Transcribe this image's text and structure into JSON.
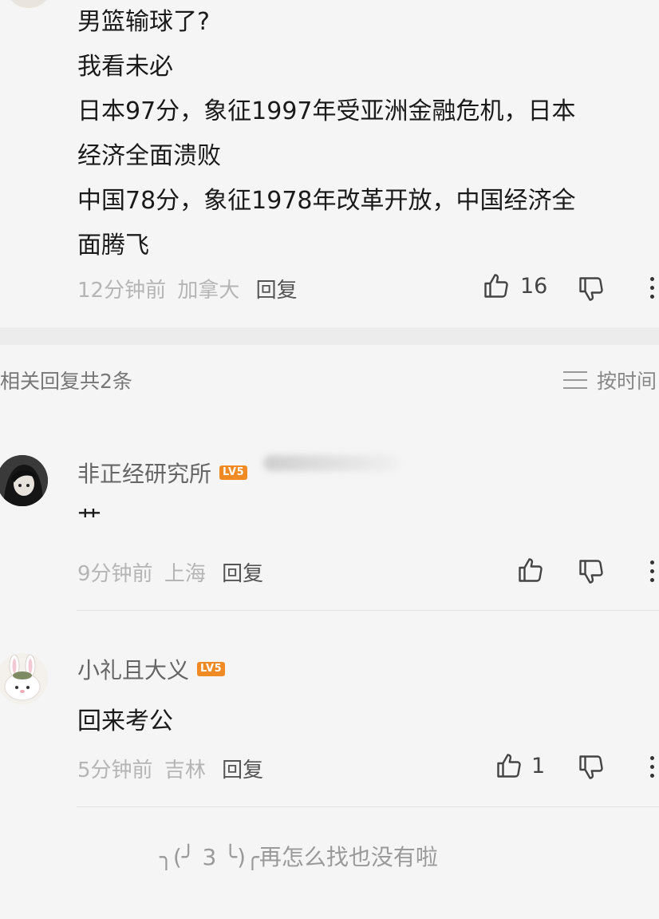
{
  "main_comment": {
    "lines": [
      "男篮输球了?",
      "我看未必",
      "日本97分，象征1997年受亚洲金融危机，日本",
      "经济全面溃败",
      "中国78分，象征1978年改革开放，中国经济全",
      "面腾飞"
    ],
    "time": "12分钟前",
    "location": "加拿大",
    "reply_label": "回复",
    "like_count": "16"
  },
  "replies_header": {
    "title": "相关回复共2条",
    "sort_label": "按时间"
  },
  "replies": [
    {
      "username": "非正经研究所",
      "level": "LV5",
      "text": "艹",
      "time": "9分钟前",
      "location": "上海",
      "reply_label": "回复",
      "like_count": ""
    },
    {
      "username": "小礼且大义",
      "level": "LV5",
      "text": "回来考公",
      "time": "5分钟前",
      "location": "吉林",
      "reply_label": "回复",
      "like_count": "1"
    }
  ],
  "footer": {
    "text": "╮(╯ 3 ╰)╭再怎么找也没有啦"
  },
  "icons": {
    "like": "thumbs-up-icon",
    "dislike": "thumbs-down-icon",
    "more": "more-vertical-icon",
    "sort": "sort-lines-icon"
  },
  "colors": {
    "level_badge": "#f08a24",
    "background": "#f5f5f5"
  }
}
